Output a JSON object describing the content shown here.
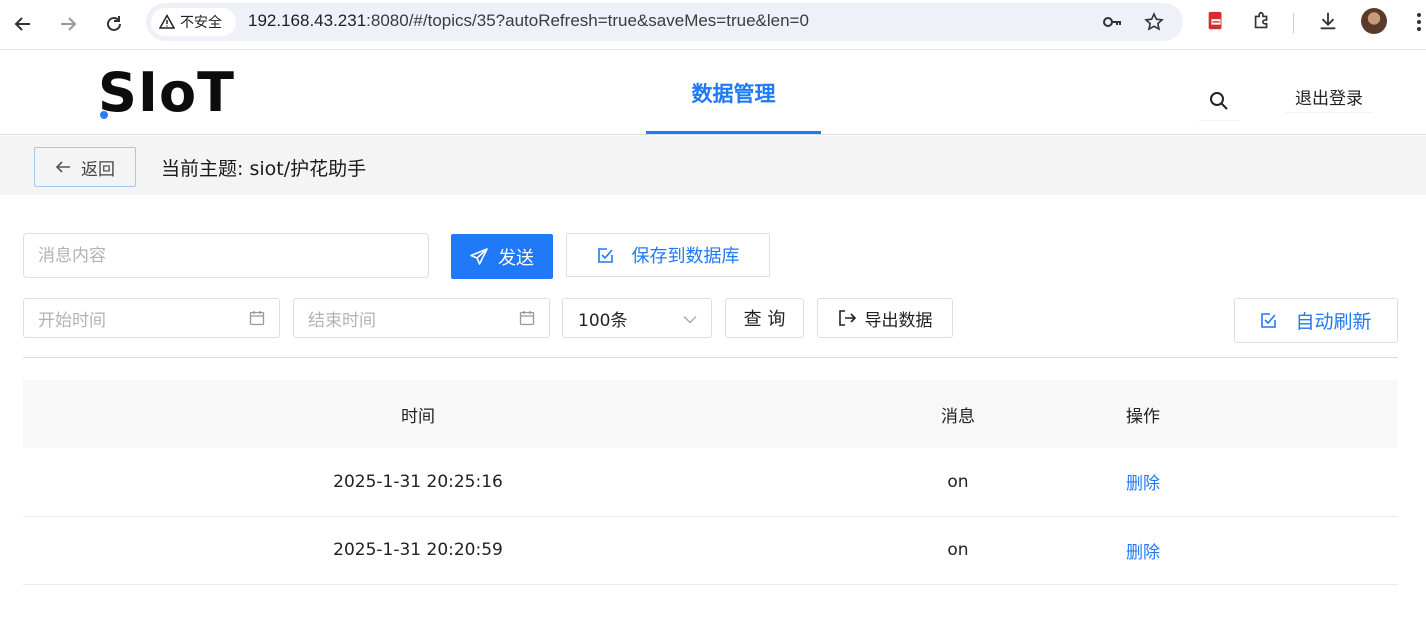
{
  "browser": {
    "security_label": "不安全",
    "url_host": "192.168.43.231",
    "url_rest": ":8080/#/topics/35?autoRefresh=true&saveMes=true&len=0"
  },
  "header": {
    "logo": "SIoT",
    "main_tab": "数据管理",
    "logout_label": "退出登录"
  },
  "subheader": {
    "back_label": "返回",
    "topic_title": "当前主题: siot/护花助手"
  },
  "toolbar": {
    "message_placeholder": "消息内容",
    "send_label": "发送",
    "save_db_label": "保存到数据库",
    "start_time_placeholder": "开始时间",
    "end_time_placeholder": "结束时间",
    "limit_value": "100条",
    "query_label": "查 询",
    "export_label": "导出数据",
    "auto_refresh_label": "自动刷新"
  },
  "table": {
    "columns": [
      "时间",
      "消息",
      "操作"
    ],
    "rows": [
      {
        "time": "2025-1-31 20:25:16",
        "message": "on",
        "action": "删除"
      },
      {
        "time": "2025-1-31 20:20:59",
        "message": "on",
        "action": "删除"
      }
    ]
  },
  "colors": {
    "accent": "#2079f6",
    "border": "#dcdfe6",
    "subheader_bg": "#f4f4f4"
  }
}
